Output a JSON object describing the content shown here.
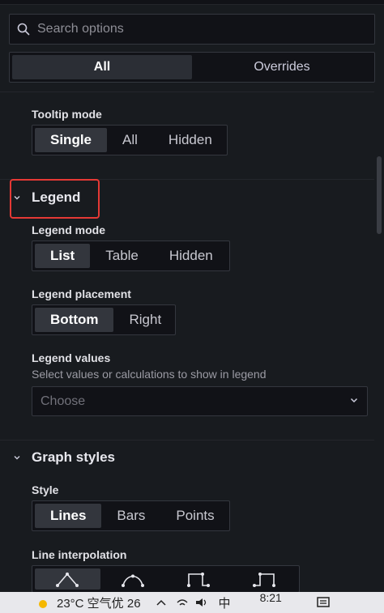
{
  "search": {
    "placeholder": "Search options",
    "icon": "search-icon"
  },
  "tabs": [
    {
      "label": "All",
      "active": true
    },
    {
      "label": "Overrides",
      "active": false
    }
  ],
  "tooltip": {
    "label": "Tooltip mode",
    "options": [
      {
        "label": "Single",
        "active": true
      },
      {
        "label": "All",
        "active": false
      },
      {
        "label": "Hidden",
        "active": false
      }
    ]
  },
  "legend": {
    "title": "Legend",
    "mode": {
      "label": "Legend mode",
      "options": [
        {
          "label": "List",
          "active": true
        },
        {
          "label": "Table",
          "active": false
        },
        {
          "label": "Hidden",
          "active": false
        }
      ]
    },
    "placement": {
      "label": "Legend placement",
      "options": [
        {
          "label": "Bottom",
          "active": true
        },
        {
          "label": "Right",
          "active": false
        }
      ]
    },
    "values": {
      "label": "Legend values",
      "description": "Select values or calculations to show in legend",
      "select_placeholder": "Choose"
    }
  },
  "graph_styles": {
    "title": "Graph styles",
    "style": {
      "label": "Style",
      "options": [
        {
          "label": "Lines",
          "active": true
        },
        {
          "label": "Bars",
          "active": false
        },
        {
          "label": "Points",
          "active": false
        }
      ]
    },
    "line_interpolation": {
      "label": "Line interpolation",
      "options": [
        {
          "icon": "linear-interpolation-icon",
          "active": true
        },
        {
          "icon": "smooth-interpolation-icon",
          "active": false
        },
        {
          "icon": "step-before-icon",
          "active": false
        },
        {
          "icon": "step-after-icon",
          "active": false
        }
      ]
    }
  },
  "taskbar": {
    "weather": "23°C 空气优 26",
    "time": "8:21",
    "ime": "中"
  },
  "colors": {
    "highlight": "#e53935",
    "background": "#181b1f",
    "active_option": "#33363d"
  }
}
